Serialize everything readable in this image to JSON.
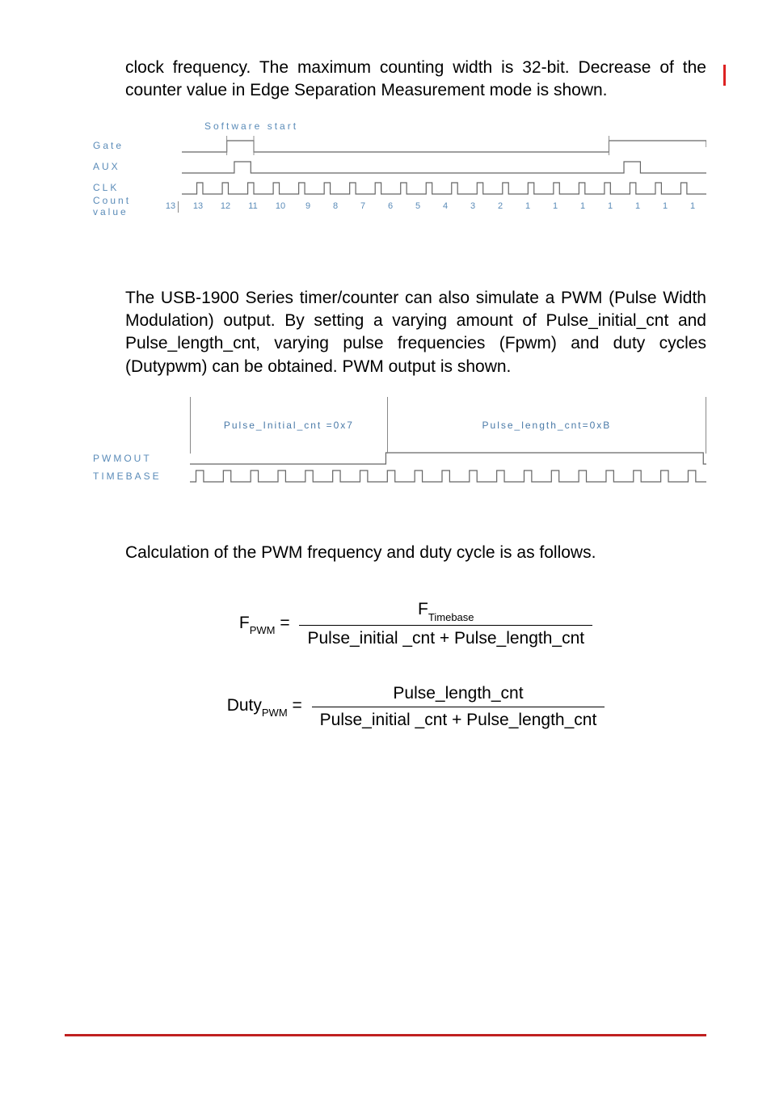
{
  "para1": "clock frequency. The maximum counting width is 32-bit. Decrease of the counter value in Edge Separation Measurement mode is shown.",
  "diag1": {
    "top_label": "Software start",
    "rows": [
      "Gate",
      "AUX",
      "CLK",
      "Count value"
    ],
    "count_values": [
      "13",
      "13",
      "12",
      "11",
      "10",
      "9",
      "8",
      "7",
      "6",
      "5",
      "4",
      "3",
      "2",
      "1",
      "1",
      "1",
      "1",
      "1",
      "1",
      "1"
    ]
  },
  "para2": "The USB-1900 Series timer/counter can also simulate a PWM (Pulse Width Modulation) output. By setting a varying amount of Pulse_initial_cnt and Pulse_length_cnt, varying pulse frequencies (Fpwm) and duty cycles (Dutypwm) can be obtained. PWM output is shown.",
  "diag2": {
    "seg1": "Pulse_Initial_cnt =0x7",
    "seg2": "Pulse_length_cnt=0xB",
    "rows": [
      "PWMOUT",
      "TIMEBASE"
    ]
  },
  "para3": "Calculation of the PWM frequency and duty cycle is as follows.",
  "formula1": {
    "lhs_main": "F",
    "lhs_sub": "PWM",
    "num_main": "F",
    "num_sub": "Timebase",
    "den": "Pulse_initial _cnt + Pulse_length_cnt"
  },
  "formula2": {
    "lhs_main": "Duty",
    "lhs_sub": "PWM",
    "num": "Pulse_length_cnt",
    "den": "Pulse_initial _cnt + Pulse_length_cnt"
  }
}
